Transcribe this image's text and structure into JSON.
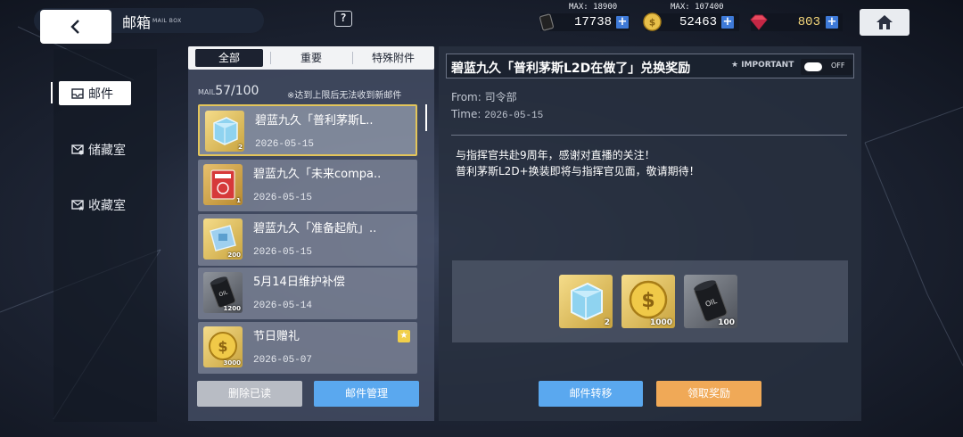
{
  "header": {
    "title": "邮箱",
    "title_en": "MAIL BOX",
    "help_label": "?"
  },
  "resources": [
    {
      "icon": "oil-icon",
      "max_label": "MAX: 18900",
      "value": "17738"
    },
    {
      "icon": "coin-icon",
      "max_label": "MAX: 107400",
      "value": "52463"
    },
    {
      "icon": "gem-icon",
      "max_label": "",
      "value": "803"
    }
  ],
  "sidebar": {
    "items": [
      {
        "label": "邮件",
        "icon": "mail-icon"
      },
      {
        "label": "储藏室",
        "icon": "storage-mail-icon"
      },
      {
        "label": "收藏室",
        "icon": "saved-mail-icon"
      }
    ]
  },
  "tabs": [
    {
      "label": "全部"
    },
    {
      "label": "重要"
    },
    {
      "label": "特殊附件"
    }
  ],
  "mailbox": {
    "count_label": "MAIL",
    "count": "57/100",
    "note": "※达到上限后无法收到新邮件"
  },
  "mails": [
    {
      "title": "碧蓝九久「普利茅斯L..",
      "date": "2026-05-15",
      "icon": "cube-icon",
      "qty": "2",
      "starred": false
    },
    {
      "title": "碧蓝九久「未来compa..",
      "date": "2026-05-15",
      "icon": "book-icon",
      "qty": "1",
      "starred": false
    },
    {
      "title": "碧蓝九久「准备起航」..",
      "date": "2026-05-15",
      "icon": "blueprint-icon",
      "qty": "200",
      "starred": false
    },
    {
      "title": "5月14日维护补偿",
      "date": "2026-05-14",
      "icon": "oil-barrel-icon",
      "qty": "1200",
      "starred": false
    },
    {
      "title": "节日赠礼",
      "date": "2026-05-07",
      "icon": "coin-icon",
      "qty": "3000",
      "starred": true
    }
  ],
  "list_buttons": {
    "delete_read": "删除已读",
    "manage": "邮件管理"
  },
  "detail": {
    "title": "碧蓝九久「普利茅斯L2D在做了」兑换奖励",
    "important_label": "IMPORTANT",
    "toggle_state": "OFF",
    "from": "From: 司令部",
    "time_label": "Time:",
    "time_value": "2026-05-15",
    "body_line1": "与指挥官共赴9周年，感谢对直播的关注！",
    "body_line2": "普利茅斯L2D+换装即将与指挥官见面，敬请期待！",
    "attachments": [
      {
        "icon": "cube-icon",
        "qty": "2"
      },
      {
        "icon": "coin-icon",
        "qty": "1000"
      },
      {
        "icon": "oil-barrel-icon",
        "qty": "100"
      }
    ],
    "transfer_label": "邮件转移",
    "claim_label": "领取奖励"
  },
  "colors": {
    "accent_blue": "#5aa8ef",
    "accent_orange": "#f0a957",
    "selected_border": "#e3c55a",
    "plus_blue": "#3e7ad8"
  }
}
